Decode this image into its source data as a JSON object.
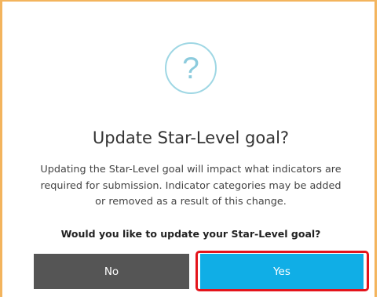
{
  "dialog": {
    "icon": {
      "name": "question-mark-icon",
      "glyph": "?",
      "color": "#8ccbdd"
    },
    "title": "Update Star-Level goal?",
    "body_lines": [
      "Updating the Star-Level goal will impact what indicators are",
      "required for submission. Indicator categories may be added",
      "or removed as a result of this change."
    ],
    "question": "Would you like to update your Star-Level goal?",
    "buttons": {
      "no_label": "No",
      "yes_label": "Yes"
    },
    "colors": {
      "border": "#f3b45d",
      "no_button": "#555555",
      "yes_button": "#10aee6",
      "highlight": "#e4141b"
    }
  }
}
